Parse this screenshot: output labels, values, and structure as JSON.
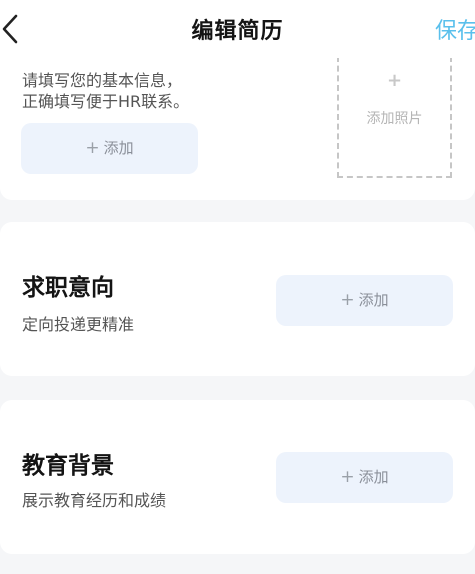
{
  "header": {
    "title": "编辑简历",
    "save_label": "保存"
  },
  "basic_info": {
    "desc_line1": "请填写您的基本信息，",
    "desc_line2": "正确填写便于HR联系。",
    "add_label": "添加",
    "photo_plus": "+",
    "photo_label": "添加照片"
  },
  "job_intent": {
    "title": "求职意向",
    "subtitle": "定向投递更精准",
    "add_label": "添加"
  },
  "education": {
    "title": "教育背景",
    "subtitle": "展示教育经历和成绩",
    "add_label": "添加"
  },
  "icons": {
    "back": "chevron-left-icon",
    "plus": "plus-icon"
  },
  "colors": {
    "accent": "#5ac0ec",
    "add_button_bg": "#edf3fc",
    "page_bg": "#f5f6f8"
  }
}
